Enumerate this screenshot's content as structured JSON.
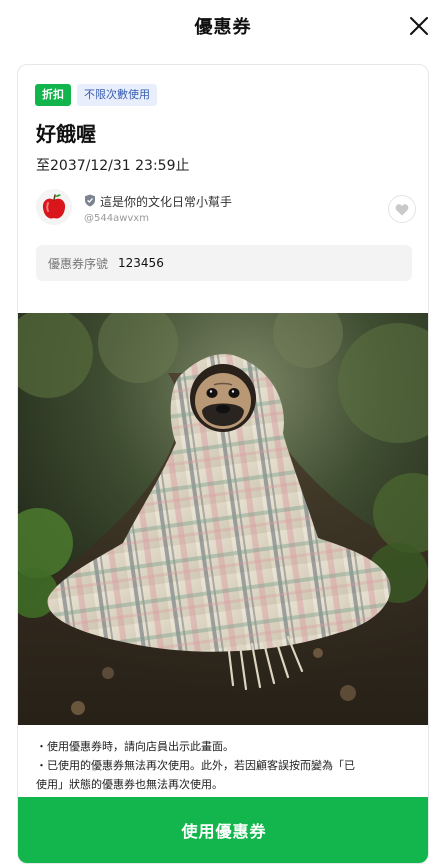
{
  "header": {
    "title": "優惠券"
  },
  "coupon": {
    "badges": [
      "折扣",
      "不限次數使用"
    ],
    "title": "好餓喔",
    "expiry": "至2037/12/31 23:59止"
  },
  "profile": {
    "name": "這是你的文化日常小幫手",
    "id": "@544awvxm"
  },
  "serial": {
    "label": "優惠券序號",
    "value": "123456"
  },
  "notes": [
    "・使用優惠券時，請向店員出示此畫面。",
    "・已使用的優惠券無法再次使用。此外，若因顧客誤按而變為「已",
    "使用」狀態的優惠券也無法再次使用。"
  ],
  "actions": {
    "use_label": "使用優惠券"
  },
  "colors": {
    "accent_green": "#13b64d",
    "badge_blue_bg": "#e8eefc",
    "badge_blue_text": "#3a5fb0"
  },
  "icons": {
    "close": "close-icon",
    "official": "shield-icon",
    "like": "heart-icon"
  }
}
